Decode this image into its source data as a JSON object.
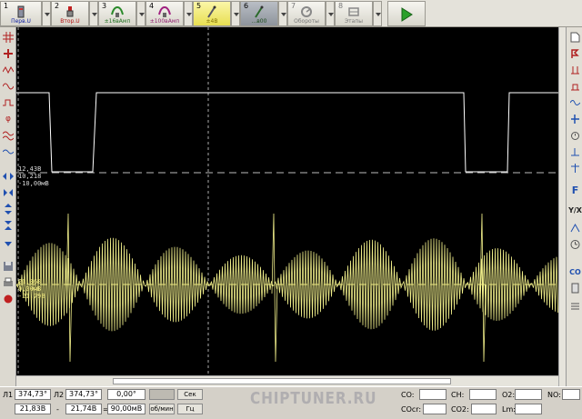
{
  "toolbar": {
    "buttons": [
      {
        "num": "1",
        "label": "Перв.U"
      },
      {
        "num": "2",
        "label": "Втор.U"
      },
      {
        "num": "3",
        "label": "±16вАмп"
      },
      {
        "num": "4",
        "label": "±100вАмп"
      },
      {
        "num": "5",
        "label": "±4В"
      },
      {
        "num": "6",
        "label": "...в00"
      },
      {
        "num": "7",
        "label": "Обороты"
      },
      {
        "num": "8",
        "label": "Этапы"
      }
    ]
  },
  "scope": {
    "ch1_labels": [
      "12,43В",
      "10,218",
      "-10,00мВ"
    ],
    "ch2_labels": [
      "20,868",
      "0,00мВ",
      "-21,79В"
    ]
  },
  "status": {
    "l1_label": "Л1",
    "l1_value": "374,73°",
    "l2_label": "Л2",
    "l2_value": "374,73°",
    "angle_value": "0,00°",
    "unit_sec": "Сек",
    "v1": "21,83В",
    "dash": "-",
    "v2": "21,74В",
    "eq": "=",
    "v3": "90,00мВ",
    "mode": "об/мин",
    "unit_hz": "Гц",
    "watermark": "CHIPTUNER.RU",
    "gas": [
      {
        "label": "CO:",
        "value": ""
      },
      {
        "label": "CH:",
        "value": ""
      },
      {
        "label": "O2:",
        "value": ""
      },
      {
        "label": "NO:",
        "value": ""
      },
      {
        "label": "COcr:",
        "value": ""
      },
      {
        "label": "CO2:",
        "value": ""
      },
      {
        "label": "Lm:",
        "value": ""
      }
    ]
  },
  "colors": {
    "trace1": "#ffffff",
    "trace2": "#f0ee8a",
    "background": "#000000"
  }
}
